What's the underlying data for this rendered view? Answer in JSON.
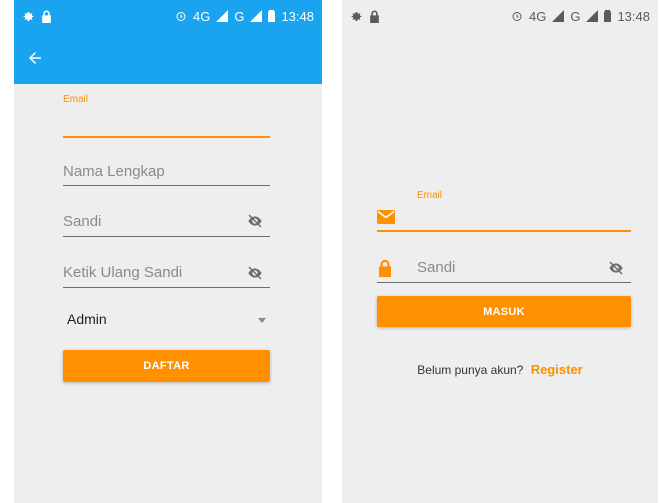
{
  "colors": {
    "primary": "#1aa3ee",
    "accent": "#ff9100",
    "background": "#eeeeee",
    "hint": "#8a8a8a"
  },
  "status_bar": {
    "icons": [
      "settings-icon",
      "lock-icon",
      "alarm-icon",
      "signal-4g-icon",
      "signal-g-icon",
      "battery-icon"
    ],
    "network_4g": "4G",
    "network_g": "G",
    "time": "13:48"
  },
  "register_screen": {
    "email_label": "Email",
    "full_name_hint": "Nama Lengkap",
    "password_hint": "Sandi",
    "repeat_password_hint": "Ketik Ulang Sandi",
    "role_selected": "Admin",
    "submit_label": "DAFTAR"
  },
  "login_screen": {
    "email_label": "Email",
    "password_hint": "Sandi",
    "submit_label": "MASUK",
    "no_account_text": "Belum punya akun?",
    "register_link": "Register"
  }
}
